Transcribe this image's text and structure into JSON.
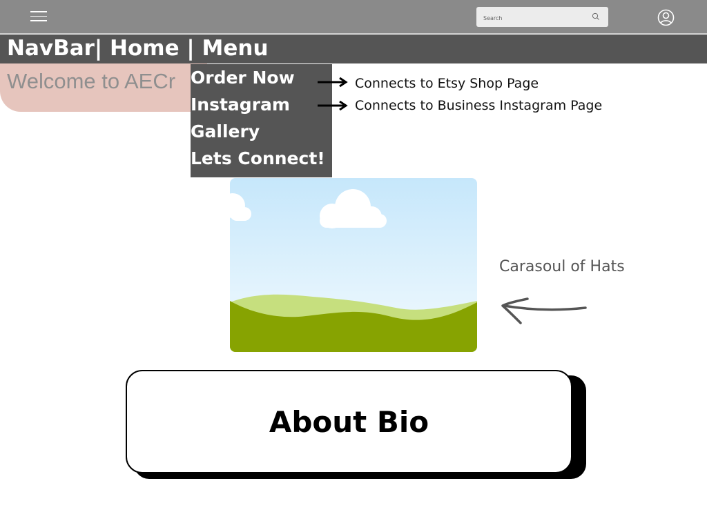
{
  "topbar": {
    "menu_icon": "hamburger-menu-icon",
    "search": {
      "placeholder": "Search",
      "icon": "search-icon"
    },
    "profile_icon": "user-circle-icon",
    "background": "#8a8a8a"
  },
  "navbar": {
    "title": "NavBar| Home | Menu",
    "background": "#555555"
  },
  "hero": {
    "welcome_text": "Welcome to AECr",
    "blob_color": "#e6c5bd"
  },
  "dropdown": {
    "items": [
      {
        "label": "Order Now"
      },
      {
        "label": "Instagram"
      },
      {
        "label": "Gallery"
      },
      {
        "label": "Lets Connect!"
      }
    ]
  },
  "notes": [
    {
      "text": "Connects to Etsy Shop Page",
      "icon": "arrow-right-icon"
    },
    {
      "text": "Connects to Business Instagram Page",
      "icon": "arrow-right-icon"
    }
  ],
  "image_placeholder": {
    "icon": "landscape-image-icon",
    "sky_color": "#c6e7fb",
    "hill_color": "#87a301"
  },
  "carousel": {
    "label": "Carasoul of Hats",
    "icon": "arrow-left-icon"
  },
  "bio": {
    "label": "About Bio"
  }
}
